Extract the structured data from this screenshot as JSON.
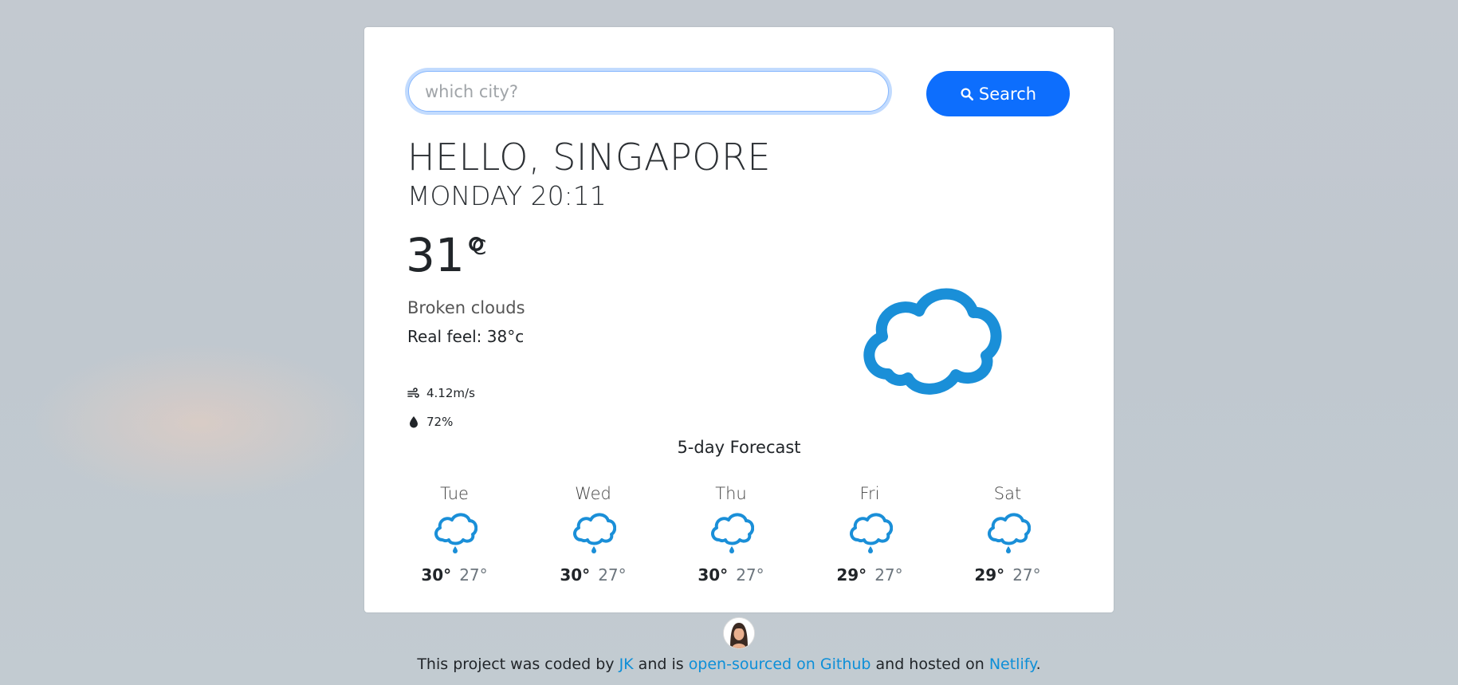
{
  "search": {
    "placeholder": "which city?",
    "button_label": "Search"
  },
  "current": {
    "greeting": "HELLO, SINGAPORE",
    "datetime": "MONDAY 20:11",
    "temperature": "31°",
    "unit": "C",
    "description": "Broken clouds",
    "real_feel": "Real feel: 38°c",
    "wind": "4.12m/s",
    "humidity": "72%",
    "icon": "cloud-icon"
  },
  "forecast": {
    "title": "5-day Forecast",
    "days": [
      {
        "day": "Tue",
        "max": "30°",
        "min": "27°",
        "icon": "rain-cloud-icon"
      },
      {
        "day": "Wed",
        "max": "30°",
        "min": "27°",
        "icon": "rain-cloud-icon"
      },
      {
        "day": "Thu",
        "max": "30°",
        "min": "27°",
        "icon": "rain-cloud-icon"
      },
      {
        "day": "Fri",
        "max": "29°",
        "min": "27°",
        "icon": "rain-cloud-icon"
      },
      {
        "day": "Sat",
        "max": "29°",
        "min": "27°",
        "icon": "rain-cloud-icon"
      }
    ]
  },
  "footer": {
    "text_1": "This project was coded by ",
    "author_link": "JK",
    "text_2": " and is ",
    "github_link": "open-sourced on Github",
    "text_3": " and hosted on ",
    "netlify_link": "Netlify",
    "text_4": "."
  },
  "colors": {
    "accent": "#0d6efd",
    "icon_blue": "#1a8fd8",
    "link": "#0d8fd8"
  }
}
